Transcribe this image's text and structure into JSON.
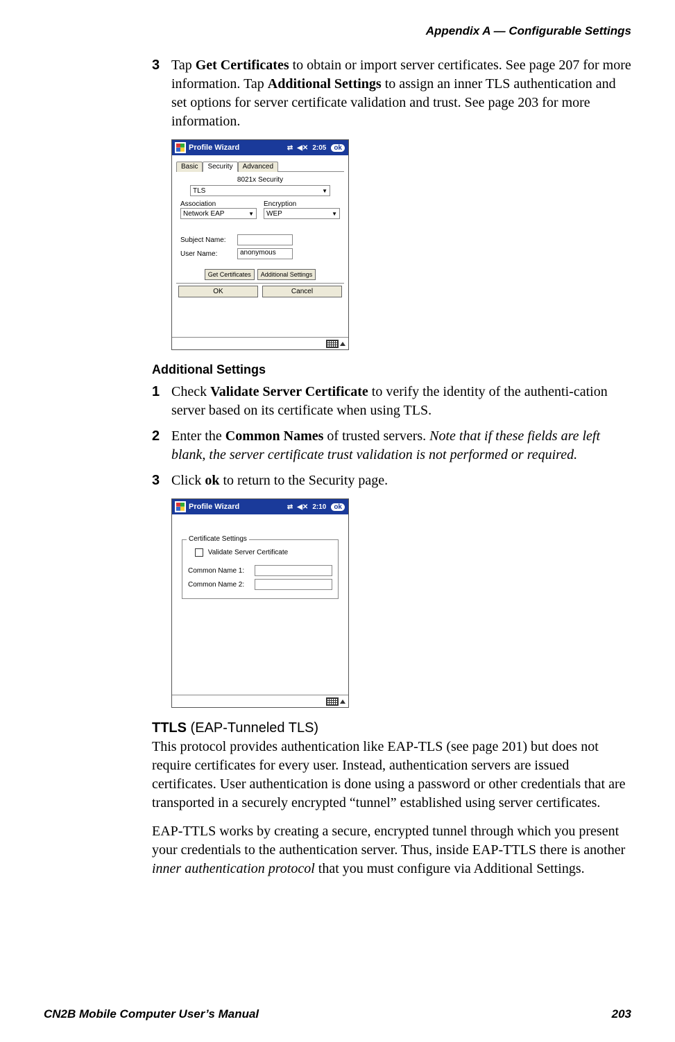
{
  "header": "Appendix A —  Configurable Settings",
  "step3": {
    "num": "3",
    "t1": "Tap ",
    "b1": "Get Certificates",
    "t2": " to obtain or import server certificates. See page 207 for more information. Tap ",
    "b2": "Additional Settings",
    "t3": " to assign an inner TLS authentication and set options for server certificate validation and trust. See page 203 for more information."
  },
  "shot1": {
    "title": "Profile Wizard",
    "time": "2:05",
    "ok": "ok",
    "tabs": {
      "basic": "Basic",
      "security": "Security",
      "advanced": "Advanced"
    },
    "security_label": "8021x Security",
    "tls": "TLS",
    "assoc_label": "Association",
    "enc_label": "Encryption",
    "assoc_val": "Network EAP",
    "enc_val": "WEP",
    "subject": "Subject Name:",
    "user": "User Name:",
    "user_val": "anonymous",
    "get_cert": "Get Certificates",
    "add_set": "Additional Settings",
    "okbtn": "OK",
    "cancel": "Cancel"
  },
  "addl_heading": "Additional Settings",
  "as1": {
    "num": "1",
    "t1": "Check ",
    "b1": "Validate Server Certificate",
    "t2": " to verify the identity of the authenti-cation server based on its certificate when using TLS."
  },
  "as2": {
    "num": "2",
    "t1": "Enter the ",
    "b1": "Common Names",
    "t2": " of trusted servers. ",
    "i1": "Note that if these fields are left blank, the server certificate trust validation is not performed or required."
  },
  "as3": {
    "num": "3",
    "t1": "Click ",
    "b1": "ok",
    "t2": " to return to the Security page."
  },
  "shot2": {
    "title": "Profile Wizard",
    "time": "2:10",
    "ok": "ok",
    "legend": "Certificate Settings",
    "validate": "Validate Server Certificate",
    "cn1": "Common Name 1:",
    "cn2": "Common Name 2:"
  },
  "ttls": {
    "head_bold": "TTLS",
    "head_rest": " (EAP-Tunneled TLS)",
    "p1": "This protocol provides authentication like EAP-TLS (see page 201) but does not require certificates for every user. Instead, authentication servers are issued certificates. User authentication is done using a password or other credentials that are transported in a securely encrypted “tunnel” established using server certificates.",
    "p2a": "EAP-TTLS works by creating a secure, encrypted tunnel through which you present your credentials to the authentication server. Thus, inside EAP-TTLS there is another ",
    "p2i": "inner authentication protocol",
    "p2b": " that you must configure via Additional Settings."
  },
  "footer": {
    "left": "CN2B Mobile Computer User’s Manual",
    "right": "203"
  }
}
